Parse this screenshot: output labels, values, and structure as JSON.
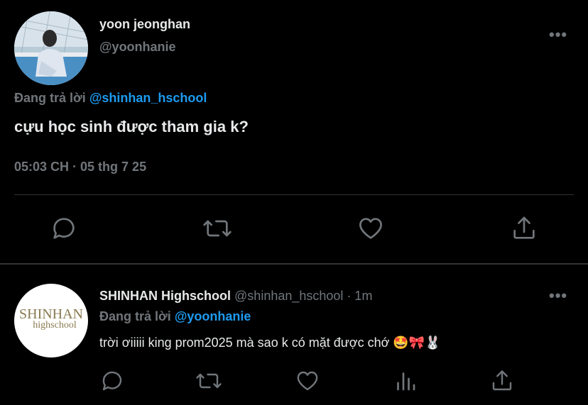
{
  "main_tweet": {
    "display_name": "yoon jeonghan",
    "handle": "@yoonhanie",
    "reply_prefix": "Đang trả lời",
    "reply_to": "@shinhan_hschool",
    "text": "cựu học sinh được tham gia k?",
    "timestamp": "05:03 CH · 05 thg 7 25",
    "more_icon": "more-horizontal-icon"
  },
  "reply_tweet": {
    "display_name": "SHINHAN Highschool",
    "handle": "@shinhan_hschool",
    "time": "· 1m",
    "reply_prefix": "Đang trả lời",
    "reply_to": "@yoonhanie",
    "text": "trời ơiiiii king prom2025 mà sao k có mặt được chớ 🤩🎀🐰",
    "avatar_logo_line1": "SHINHAN",
    "avatar_logo_line2": "highschool"
  },
  "colors": {
    "background": "#000000",
    "text": "#e7e9ea",
    "muted": "#71767b",
    "accent": "#1d9bf0",
    "divider": "#2f3336"
  }
}
